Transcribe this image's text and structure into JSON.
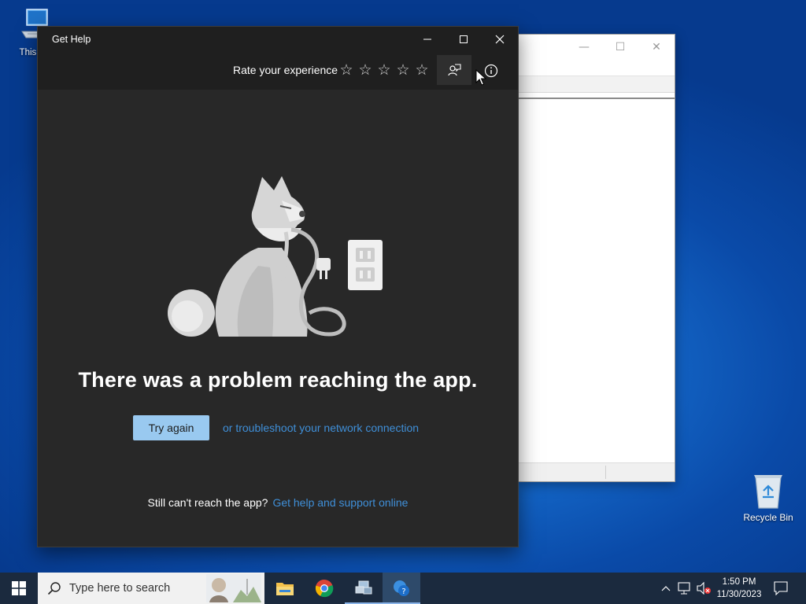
{
  "desktop": {
    "this_pc_label": "This PC",
    "recycle_bin_label": "Recycle Bin"
  },
  "window": {
    "title": "Get Help",
    "rate_label": "Rate your experience",
    "stars": [
      "star-1",
      "star-2",
      "star-3",
      "star-4",
      "star-5"
    ],
    "error_message": "There was a problem reaching the app.",
    "try_again_label": "Try again",
    "troubleshoot_link": "or troubleshoot your network connection",
    "still_cant_reach": "Still can't reach the app?",
    "support_link": "Get help and support online"
  },
  "taskbar": {
    "search_placeholder": "Type here to search",
    "apps": [
      "file-explorer",
      "chrome",
      "network-app",
      "get-help"
    ],
    "time": "1:50 PM",
    "date": "11/30/2023"
  },
  "colors": {
    "window_bg": "#282828",
    "title_bar": "#1f1f1f",
    "link": "#3f8fd8",
    "button": "#99c9f0",
    "taskbar": "#1b2a3e"
  }
}
